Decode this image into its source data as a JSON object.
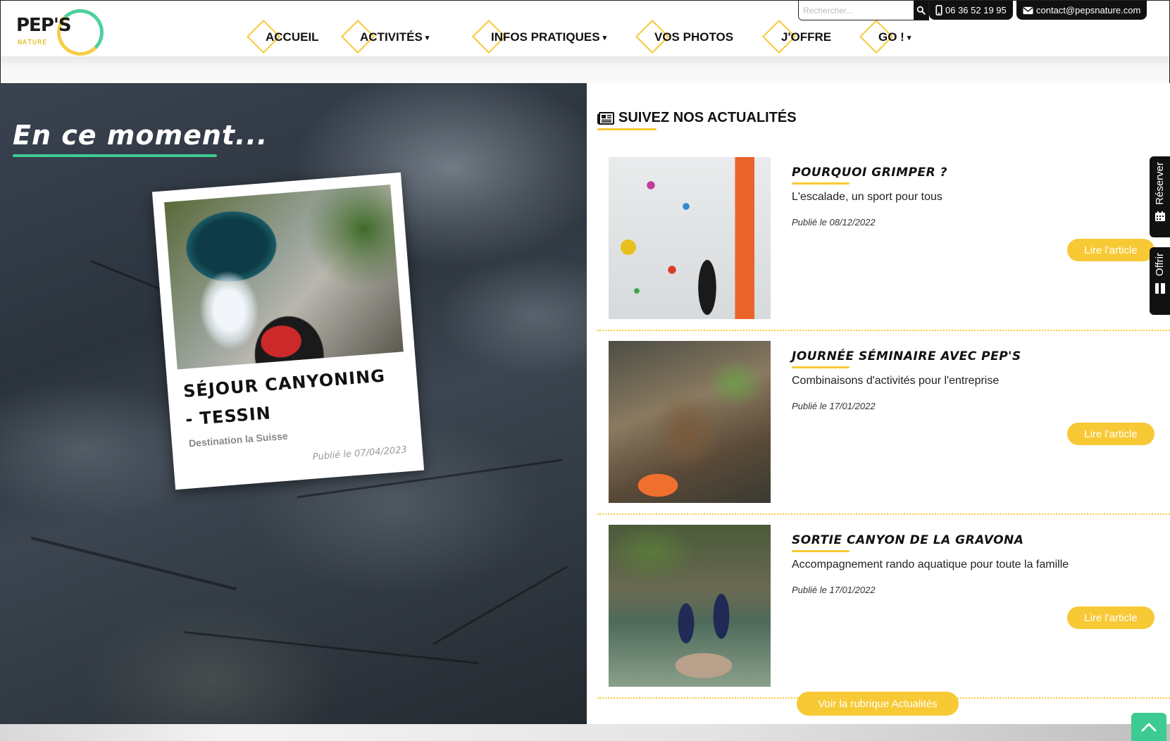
{
  "brand": {
    "name": "PEP'S",
    "sub": "NATURE"
  },
  "nav": {
    "items": [
      {
        "label": "ACCUEIL",
        "has_caret": false
      },
      {
        "label": "ACTIVITÉS",
        "has_caret": true
      },
      {
        "label": "INFOS PRATIQUES",
        "has_caret": true
      },
      {
        "label": "VOS PHOTOS",
        "has_caret": false
      },
      {
        "label": "J'OFFRE",
        "has_caret": false
      },
      {
        "label": "GO !",
        "has_caret": true
      }
    ],
    "caret": "▾"
  },
  "topbar": {
    "search_placeholder": "Rechercher...",
    "phone": "06 36 52 19 95",
    "email": "contact@pepsnature.com"
  },
  "hero": {
    "title": "En ce moment...",
    "card": {
      "title": "SÉJOUR CANYONING - TESSIN",
      "subtitle": "Destination la Suisse",
      "date": "Publié le 07/04/2023"
    }
  },
  "news": {
    "heading": "SUIVEZ NOS ACTUALITÉS",
    "read_label": "Lire l'article",
    "articles": [
      {
        "title": "POURQUOI GRIMPER ?",
        "description": "L'escalade, un sport pour tous",
        "date": "Publié le 08/12/2022"
      },
      {
        "title": "JOURNÉE SÉMINAIRE AVEC PEP'S",
        "description": "Combinaisons d'activités pour l'entreprise",
        "date": "Publié le 17/01/2022"
      },
      {
        "title": "SORTIE CANYON DE LA GRAVONA",
        "description": "Accompagnement rando aquatique pour toute la famille",
        "date": "Publié le 17/01/2022"
      }
    ],
    "all_label": "Voir la rubrique Actualités"
  },
  "side_tabs": {
    "reserve": "Réserver",
    "offer": "Offrir"
  },
  "colors": {
    "accent_yellow": "#f7c935",
    "accent_green": "#3ccb92",
    "dark": "#111111"
  }
}
